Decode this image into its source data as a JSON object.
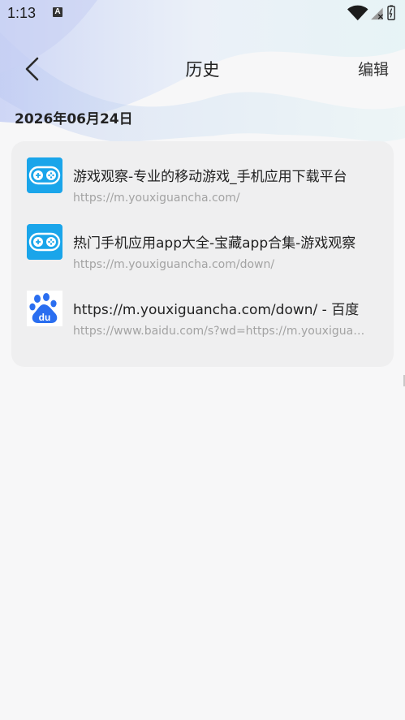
{
  "status_bar": {
    "time": "1:13",
    "notification_letter": "A"
  },
  "nav": {
    "back_icon": "chevron-left-icon",
    "title": "历史",
    "edit_label": "编辑"
  },
  "history": {
    "date_label": "2026年06月24日",
    "items": [
      {
        "title": "游戏观察-专业的移动游戏_手机应用下载平台",
        "url": "https://m.youxiguancha.com/",
        "icon": "gamepad-icon"
      },
      {
        "title": "热门手机应用app大全-宝藏app合集-游戏观察",
        "url": "https://m.youxiguancha.com/down/",
        "icon": "gamepad-icon"
      },
      {
        "title": "https://m.youxiguancha.com/down/ - 百度",
        "url": "https://www.baidu.com/s?wd=https://m.youxiguancha.com/down/",
        "icon": "baidu-paw-icon"
      }
    ]
  },
  "colors": {
    "game_icon_bg": "#1aa5ea",
    "baidu_blue": "#2a6ef0",
    "card_bg": "#efeff0"
  }
}
